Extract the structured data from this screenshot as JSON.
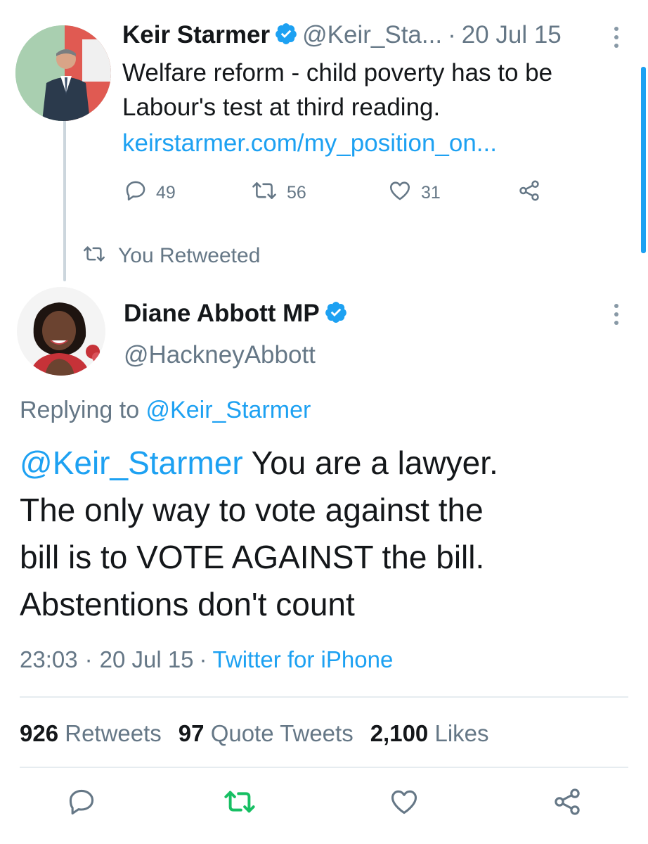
{
  "parent_tweet": {
    "display_name": "Keir Starmer",
    "handle": "@Keir_Sta...",
    "separator": "·",
    "date": "20 Jul 15",
    "text_line1": "Welfare reform - child poverty has to be",
    "text_line2": "Labour's test at third reading.",
    "link": "keirstarmer.com/my_position_on...",
    "replies": "49",
    "retweets": "56",
    "likes": "31",
    "icons": [
      "reply-icon",
      "retweet-icon",
      "like-icon",
      "share-icon"
    ]
  },
  "retweet_context": {
    "label": "You Retweeted"
  },
  "main_tweet": {
    "display_name": "Diane Abbott MP",
    "handle": "@HackneyAbbott",
    "replying_prefix": "Replying to ",
    "replying_to": "@Keir_Starmer",
    "mention": "@Keir_Starmer",
    "text_line1_rest": " You are a lawyer.",
    "text_line2": "The only way to vote against the",
    "text_line3": "bill is to VOTE AGAINST the bill.",
    "text_line4": "Abstentions don't count",
    "time": "23:03",
    "separator": "·",
    "date": "20 Jul 15",
    "source": "Twitter for iPhone",
    "stats": {
      "retweets_count": "926",
      "retweets_label": "Retweets",
      "quotes_count": "97",
      "quotes_label": "Quote Tweets",
      "likes_count": "2,100",
      "likes_label": "Likes"
    }
  },
  "colors": {
    "accent_blue": "#1da1f2",
    "retweet_green": "#17bf63",
    "secondary_text": "#657786",
    "primary_text": "#14171a"
  }
}
